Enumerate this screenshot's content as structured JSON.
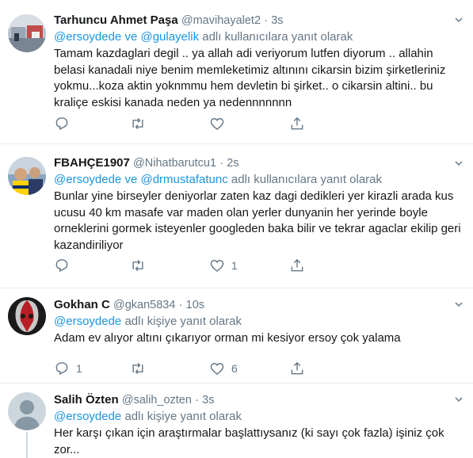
{
  "tweets": [
    {
      "name": "Tarhuncu Ahmet Paşa",
      "handle": "@mavihayalet2",
      "dot": "·",
      "time": "3s",
      "replying_to_1": "@ersoydede",
      "replying_joiner": " ve ",
      "replying_to_2": "@gulayelik",
      "replying_suffix": " adlı kullanıcılara yanıt olarak",
      "text": "Tamam kazdaglari degil .. ya allah adi veriyorum lutfen diyorum .. allahin belasi kanadali niye benim memleketimiz altınını cikarsin bizim şirketleriniz yokmu...koza aktin yoknmmu hem devletin bi şirket.. o cikarsin altini.. bu kraliçe eskisi kanada neden ya nedennnnnnn",
      "counts": {
        "reply": "",
        "retweet": "",
        "like": ""
      }
    },
    {
      "name": "FBAHÇE1907",
      "handle": "@Nihatbarutcu1",
      "dot": "·",
      "time": "2s",
      "replying_to_1": "@ersoydede",
      "replying_joiner": " ve ",
      "replying_to_2": "@drmustafatunc",
      "replying_suffix": " adlı kullanıcılara yanıt olarak",
      "text": "Bunlar yine birseyler deniyorlar zaten kaz dagi dedikleri yer kirazli arada kus ucusu 40 km masafe var maden olan yerler dunyanin her yerinde boyle orneklerini gormek isteyenler googleden baka bilir ve tekrar agaclar ekilip geri kazandiriliyor",
      "counts": {
        "reply": "",
        "retweet": "",
        "like": "1"
      }
    },
    {
      "name": "Gokhan C",
      "handle": "@gkan5834",
      "dot": "·",
      "time": "10s",
      "replying_to_1": "@ersoydede",
      "replying_suffix": " adlı kişiye yanıt olarak",
      "text": "Adam ev alıyor altını çıkarıyor orman  mi kesiyor ersoy çok yalama",
      "counts": {
        "reply": "1",
        "retweet": "",
        "like": "6"
      }
    },
    {
      "name": "Salih Özten",
      "handle": "@salih_ozten",
      "dot": "·",
      "time": "3s",
      "replying_to_1": "@ersoydede",
      "replying_suffix": " adlı kişiye yanıt olarak",
      "text": "Her karşı çıkan için araştırmalar başlattıysanız (ki sayı çok fazla) işiniz çok zor...",
      "counts": {
        "reply": "",
        "retweet": "",
        "like": ""
      }
    }
  ],
  "colors": {
    "link": "#1b95e0",
    "secondary": "#657786",
    "primary_text": "#14171a",
    "divider": "#e6ecf0"
  },
  "icons": {
    "reply": "reply-icon",
    "retweet": "retweet-icon",
    "like": "heart-icon",
    "share": "share-icon",
    "menu": "chevron-down-icon"
  }
}
